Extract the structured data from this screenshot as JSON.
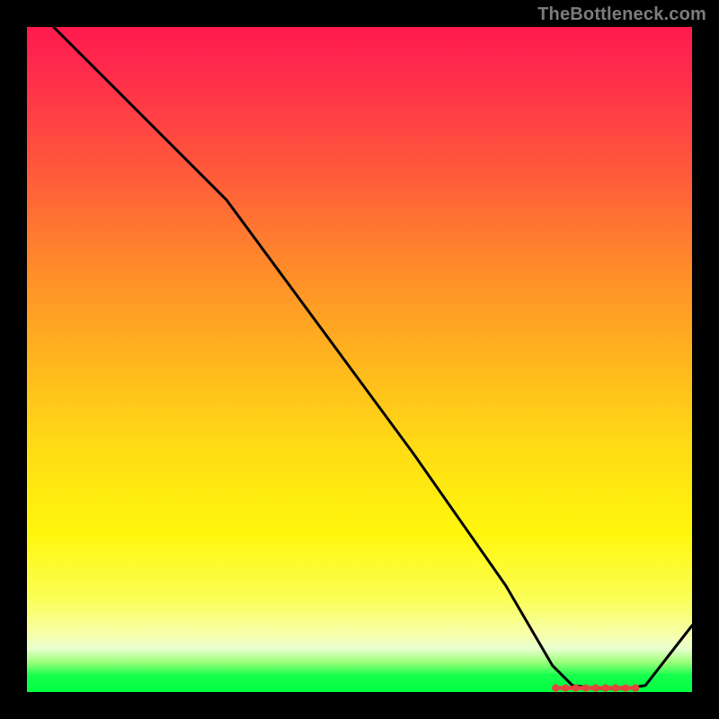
{
  "watermark": "TheBottleneck.com",
  "chart_data": {
    "type": "line",
    "title": "",
    "xlabel": "",
    "ylabel": "",
    "xlim": [
      0,
      100
    ],
    "ylim": [
      0,
      100
    ],
    "series": [
      {
        "name": "curve",
        "x": [
          4,
          12,
          22,
          30,
          44,
          58,
          72,
          79,
          82,
          86,
          90,
          93,
          100
        ],
        "y": [
          100,
          92,
          82,
          74,
          55,
          36,
          16,
          4,
          1,
          0.5,
          0.5,
          1,
          10
        ]
      }
    ],
    "markers": {
      "y": 0.6,
      "segment_x": [
        79.5,
        91.5
      ],
      "points_x": [
        79.5,
        81,
        82.5,
        84,
        85.5,
        87,
        88.5,
        90,
        91.5
      ]
    },
    "gradient_stops": [
      {
        "pos": 0,
        "color": "#ff1a4e"
      },
      {
        "pos": 0.5,
        "color": "#ffb51e"
      },
      {
        "pos": 0.8,
        "color": "#fff60c"
      },
      {
        "pos": 0.94,
        "color": "#e8ffce"
      },
      {
        "pos": 1.0,
        "color": "#00ff41"
      }
    ]
  }
}
